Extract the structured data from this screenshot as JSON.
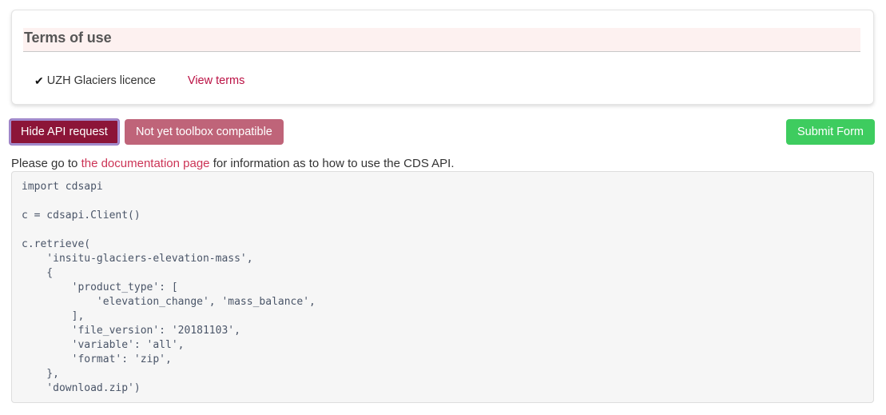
{
  "terms_card": {
    "header_title": "Terms of use",
    "check_icon": "✔",
    "licence_label": "UZH Glaciers licence",
    "view_terms_label": "View terms"
  },
  "buttons": {
    "hide_api_label": "Hide API request",
    "toolbox_label": "Not yet toolbox compatible",
    "submit_label": "Submit Form"
  },
  "documentation": {
    "prefix": "Please go to ",
    "link_label": "the documentation page",
    "suffix": " for information as to how to use the CDS API."
  },
  "code": {
    "content": "import cdsapi\n\nc = cdsapi.Client()\n\nc.retrieve(\n    'insitu-glaciers-elevation-mass',\n    {\n        'product_type': [\n            'elevation_change', 'mass_balance',\n        ],\n        'file_version': '20181103',\n        'variable': 'all',\n        'format': 'zip',\n    },\n    'download.zip')"
  },
  "colors": {
    "brand_maroon": "#8c1538",
    "brand_rose": "#bf6479",
    "submit_green": "#3ecc5f",
    "link_crimson": "#cc3355",
    "header_band_pink": "#fdf1f0",
    "code_bg": "#f6f6f6"
  }
}
